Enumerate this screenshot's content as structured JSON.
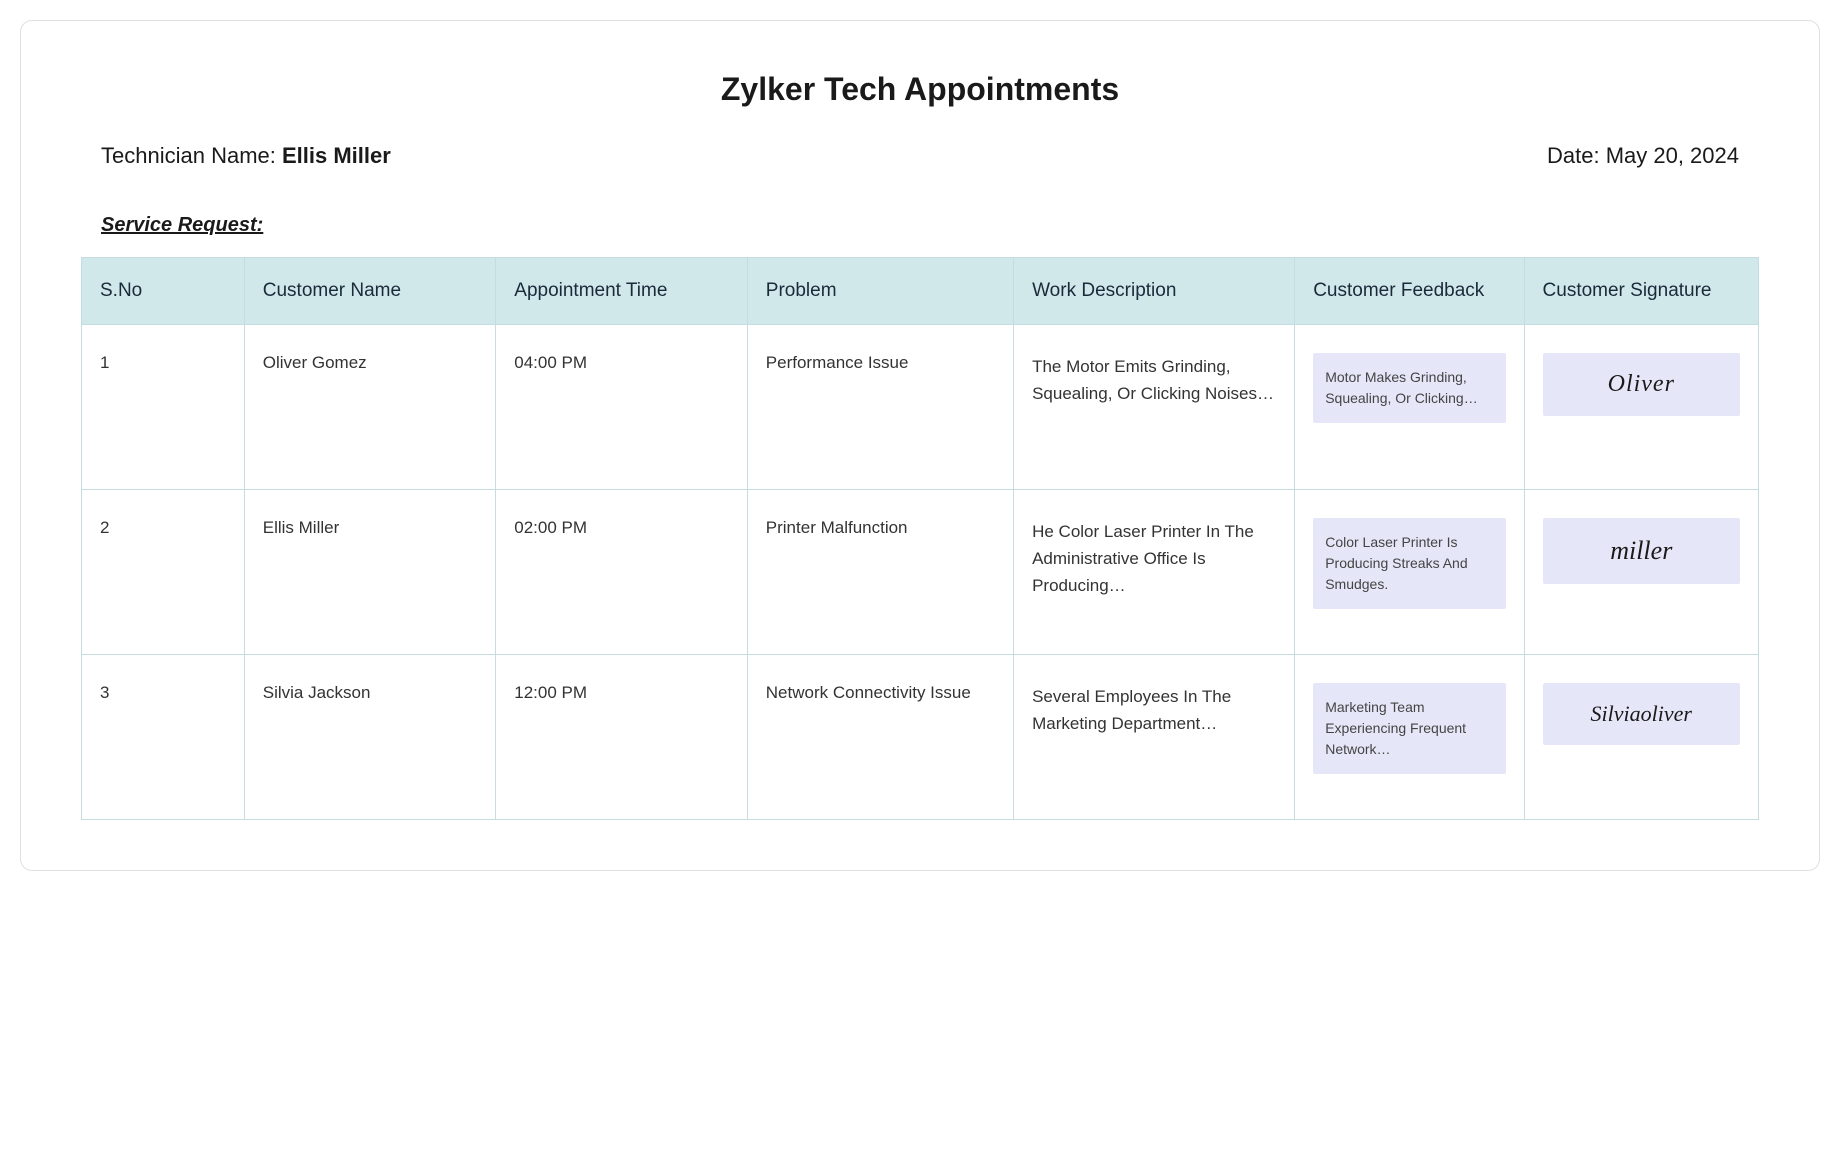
{
  "title": "Zylker Tech Appointments",
  "technician": {
    "label": "Technician Name: ",
    "name": "Ellis Miller"
  },
  "date": {
    "label": "Date: ",
    "value": "May 20, 2024"
  },
  "section_heading": "Service Request:",
  "columns": {
    "sno": "S.No",
    "customer_name": "Customer Name",
    "appointment_time": "Appointment Time",
    "problem": "Problem",
    "work_description": "Work Description",
    "customer_feedback": "Customer Feedback",
    "customer_signature": "Customer Signature"
  },
  "rows": [
    {
      "sno": "1",
      "customer_name": "Oliver Gomez",
      "appointment_time": "04:00 PM",
      "problem": "Performance Issue",
      "work_description": "The Motor Emits Grinding, Squealing, Or Clicking Noises…",
      "customer_feedback": "Motor Makes Grinding, Squealing, Or Clicking…",
      "signature": "Oliver"
    },
    {
      "sno": "2",
      "customer_name": "Ellis Miller",
      "appointment_time": "02:00 PM",
      "problem": "Printer Malfunction",
      "work_description": "He Color Laser Printer In The Administrative Office Is Producing…",
      "customer_feedback": "Color Laser Printer Is Producing Streaks And Smudges.",
      "signature": "miller"
    },
    {
      "sno": "3",
      "customer_name": "Silvia Jackson",
      "appointment_time": "12:00 PM",
      "problem": "Network Connectivity Issue",
      "work_description": "Several Employees In The Marketing Department…",
      "customer_feedback": "Marketing Team Experiencing Frequent Network…",
      "signature": "Silviaoliver"
    }
  ]
}
